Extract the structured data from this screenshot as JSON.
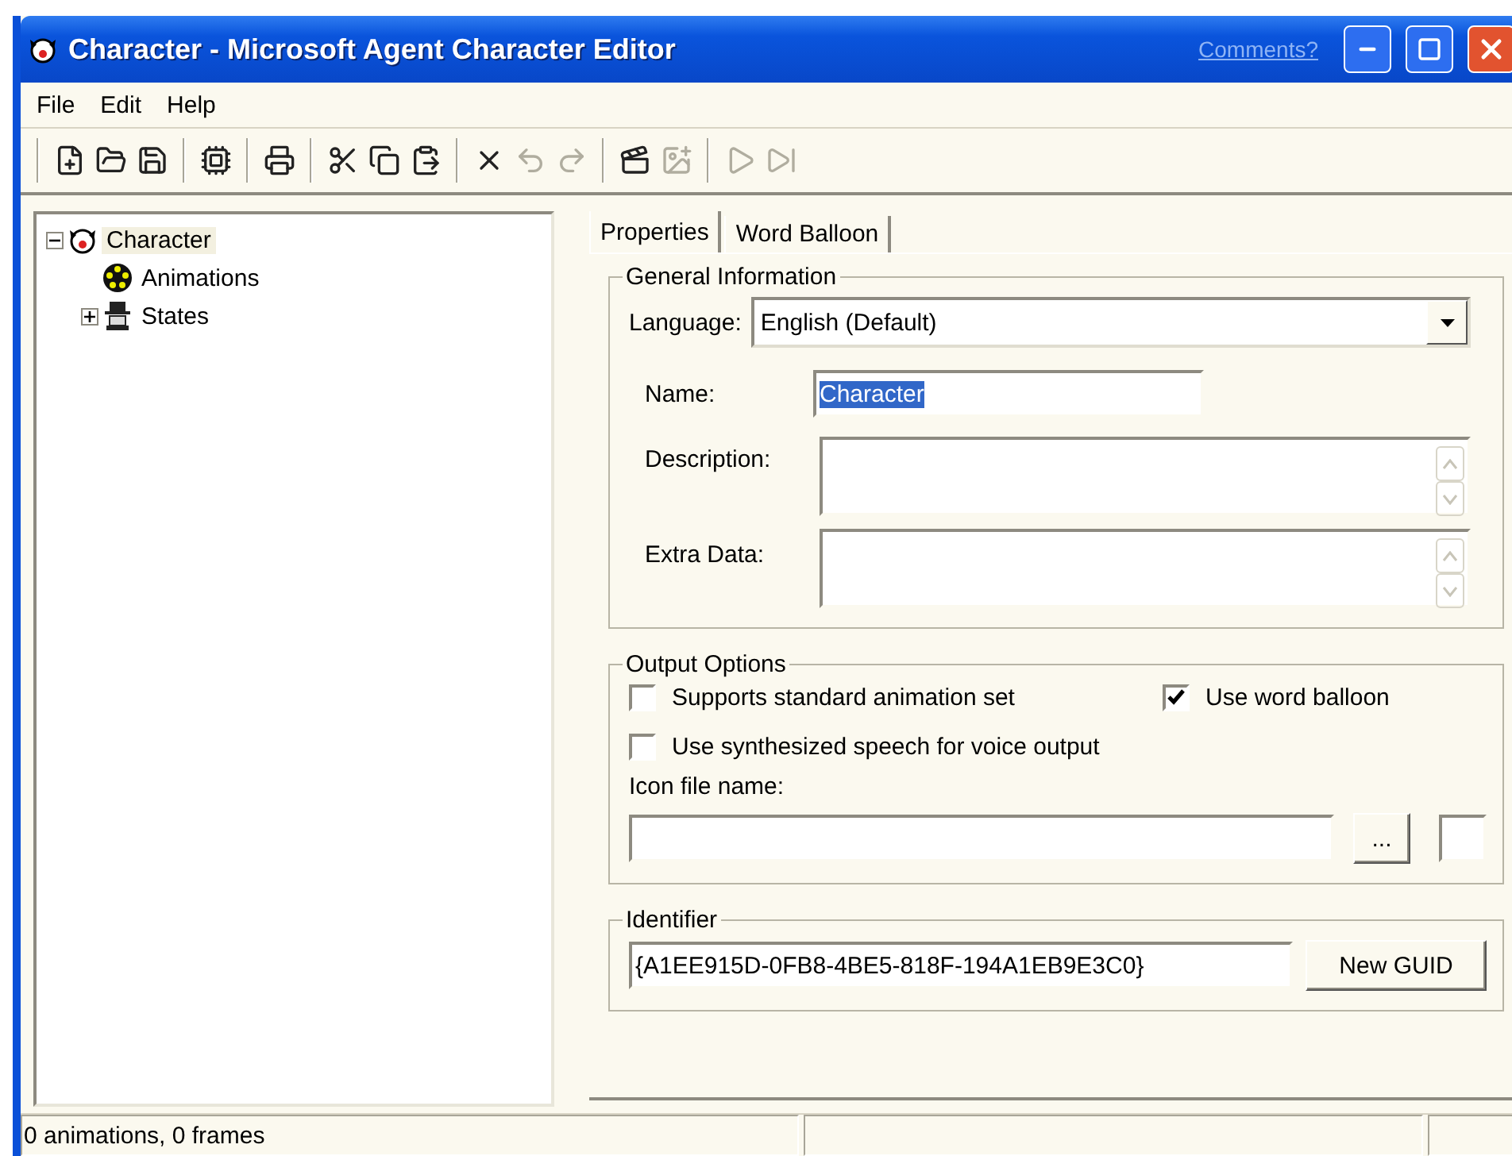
{
  "window": {
    "title": "Character - Microsoft Agent Character Editor",
    "link": "Comments?",
    "controls": [
      {
        "kind": "minimize"
      },
      {
        "kind": "maximize"
      },
      {
        "kind": "close"
      }
    ]
  },
  "menu": [
    "File",
    "Edit",
    "Help"
  ],
  "toolbar": [
    [
      {
        "kind": "new",
        "disabled": false
      },
      {
        "kind": "open",
        "disabled": false
      },
      {
        "kind": "save",
        "disabled": false
      }
    ],
    [
      {
        "kind": "compile",
        "disabled": false
      }
    ],
    [
      {
        "kind": "print",
        "disabled": false
      }
    ],
    [
      {
        "kind": "cut",
        "disabled": false
      },
      {
        "kind": "copy",
        "disabled": false
      },
      {
        "kind": "paste",
        "disabled": false
      }
    ],
    [
      {
        "kind": "delete",
        "disabled": false
      },
      {
        "kind": "undo",
        "disabled": true
      },
      {
        "kind": "redo",
        "disabled": true
      }
    ],
    [
      {
        "kind": "new-animation",
        "disabled": false
      },
      {
        "kind": "new-frame",
        "disabled": true
      }
    ],
    [
      {
        "kind": "play",
        "disabled": true
      },
      {
        "kind": "step",
        "disabled": true
      }
    ]
  ],
  "tree": [
    {
      "label": "Character",
      "kind": "character",
      "selected": true,
      "expanded": true,
      "children": [
        {
          "label": "Animations",
          "kind": "animations",
          "selected": false
        },
        {
          "label": "States",
          "kind": "states",
          "selected": false,
          "expanded": false
        }
      ]
    }
  ],
  "tabs": [
    {
      "label": "Properties",
      "selected": true
    },
    {
      "label": "Word Balloon",
      "selected": false
    }
  ],
  "general": {
    "title": "General Information",
    "language_label": "Language:",
    "language": "English (Default)",
    "name_label": "Name:",
    "name": "Character",
    "description_label": "Description:",
    "extra_label": "Extra Data:"
  },
  "output": {
    "title": "Output Options",
    "options": [
      {
        "label": "Supports standard animation set",
        "checked": false
      },
      {
        "label": "Use word balloon",
        "checked": true
      },
      {
        "label": "Use synthesized speech for voice output",
        "checked": false
      }
    ],
    "icon_label": "Icon file name:",
    "browse": "..."
  },
  "identifier": {
    "title": "Identifier",
    "value": "{A1EE915D-0FB8-4BE5-818F-194A1EB9E3C0}",
    "button": "New GUID"
  },
  "status_bar": [
    "0 animations, 0 frames"
  ]
}
